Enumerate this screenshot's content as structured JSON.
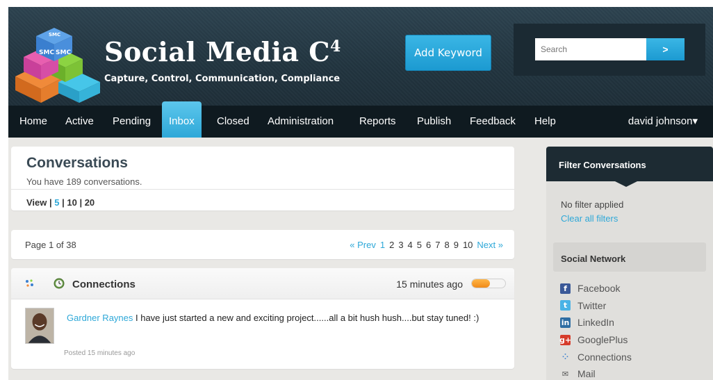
{
  "header": {
    "brand_title": "Social Media C",
    "brand_title_sup": "4",
    "brand_subtitle": "Capture, Control, Communication, Compliance",
    "logo_text": "SMC",
    "add_keyword_label": "Add Keyword",
    "search_placeholder": "Search",
    "search_button_label": ">"
  },
  "nav": {
    "items": [
      {
        "label": "Home"
      },
      {
        "label": "Active"
      },
      {
        "label": "Pending"
      },
      {
        "label": "Inbox"
      },
      {
        "label": "Closed"
      },
      {
        "label": "Administration"
      },
      {
        "label": "Reports"
      },
      {
        "label": "Publish"
      },
      {
        "label": "Feedback"
      },
      {
        "label": "Help"
      }
    ],
    "active": "Inbox",
    "user_name": "david johnson",
    "user_caret": "▾"
  },
  "conversations": {
    "title": "Conversations",
    "subtitle": "You have 189 conversations.",
    "view_label": "View |",
    "view_options": [
      "5",
      "| 10 | 20"
    ]
  },
  "pagination": {
    "page_label": "Page 1 of 38",
    "prev": "« Prev",
    "pages": [
      "1",
      "2",
      "3",
      "4",
      "5",
      "6",
      "7",
      "8",
      "9",
      "10"
    ],
    "next": "Next »",
    "current": "1"
  },
  "post": {
    "network": "Connections",
    "time": "15 minutes ago",
    "activity_level": 0.55,
    "author": "Gardner Raynes",
    "text": " I have just started a new and exciting project......all a bit hush hush....but stay tuned! :)",
    "meta": "Posted 15 minutes ago"
  },
  "sidebar": {
    "filter_title": "Filter Conversations",
    "no_filter": "No filter applied",
    "clear_filters": "Clear all filters",
    "social_network_title": "Social Network",
    "networks": [
      {
        "label": "Facebook",
        "icon": "facebook-icon",
        "glyph": "f",
        "color": "#3b5998"
      },
      {
        "label": "Twitter",
        "icon": "twitter-icon",
        "glyph": "t",
        "color": "#4ab3e6"
      },
      {
        "label": "LinkedIn",
        "icon": "linkedin-icon",
        "glyph": "in",
        "color": "#2d6da3"
      },
      {
        "label": "GooglePlus",
        "icon": "googleplus-icon",
        "glyph": "g+",
        "color": "#d63c2b"
      },
      {
        "label": "Connections",
        "icon": "connections-icon",
        "glyph": "⁘",
        "color": "#e0dfdc"
      },
      {
        "label": "Mail",
        "icon": "mail-icon",
        "glyph": "✉",
        "color": "#e0dfdc"
      }
    ]
  }
}
